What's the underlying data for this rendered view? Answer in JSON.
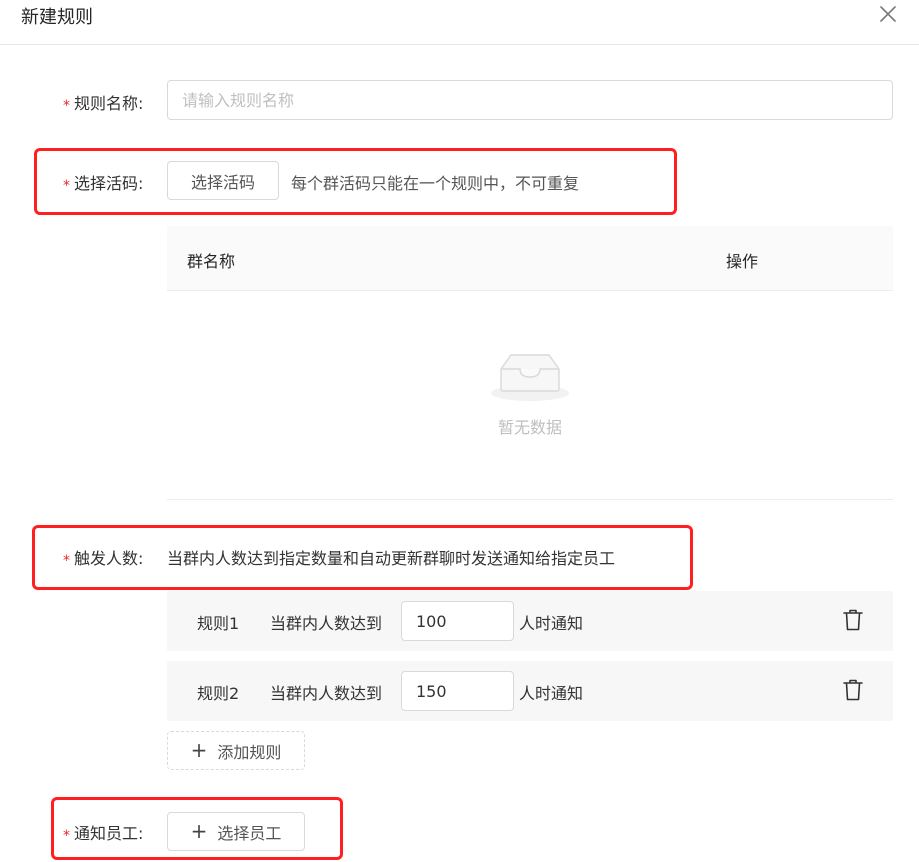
{
  "dialog": {
    "title": "新建规则"
  },
  "form": {
    "rule_name": {
      "required_mark": "*",
      "label": "规则名称:",
      "placeholder": "请输入规则名称",
      "value": ""
    },
    "select_code": {
      "required_mark": "*",
      "label": "选择活码:",
      "button_label": "选择活码",
      "hint": "每个群活码只能在一个规则中，不可重复"
    },
    "table": {
      "columns": [
        "群名称",
        "操作"
      ],
      "empty_text": "暂无数据"
    },
    "trigger": {
      "required_mark": "*",
      "label": "触发人数:",
      "description": "当群内人数达到指定数量和自动更新群聊时发送通知给指定员工"
    },
    "rules": [
      {
        "name": "规则1",
        "prefix": "当群内人数达到",
        "value": "100",
        "suffix": "人时通知"
      },
      {
        "name": "规则2",
        "prefix": "当群内人数达到",
        "value": "150",
        "suffix": "人时通知"
      }
    ],
    "add_rule_label": "添加规则",
    "notify": {
      "required_mark": "*",
      "label": "通知员工:",
      "button_label": "选择员工"
    }
  },
  "icons": {
    "close": "close-icon",
    "empty": "empty-inbox-icon",
    "delete": "trash-icon",
    "plus": "plus-icon"
  },
  "colors": {
    "required": "#f5222d",
    "highlight_box": "#ff1f1f",
    "placeholder": "#bfbfbf"
  }
}
